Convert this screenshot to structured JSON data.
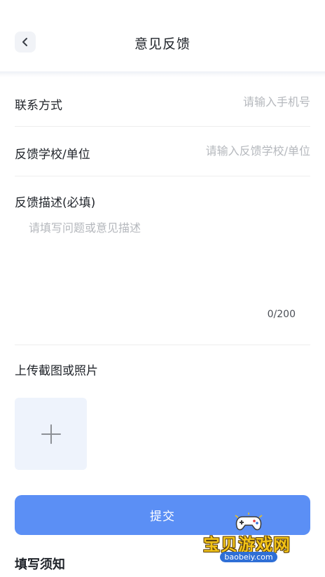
{
  "header": {
    "title": "意见反馈"
  },
  "form": {
    "contact": {
      "label": "联系方式",
      "placeholder": "请输入手机号",
      "value": ""
    },
    "school": {
      "label": "反馈学校/单位",
      "placeholder": "请输入反馈学校/单位",
      "value": ""
    },
    "description": {
      "label": "反馈描述(必填)",
      "placeholder": "请填写问题或意见描述",
      "value": "",
      "counter": "0/200"
    },
    "upload": {
      "label": "上传截图或照片",
      "icon": "plus-icon"
    },
    "submit_label": "提交"
  },
  "notice": {
    "title": "填写须知"
  },
  "watermark": {
    "text": "宝贝游戏网",
    "url": "baobeiy.com"
  },
  "colors": {
    "accent": "#5b8ff5",
    "upload_bg": "#eef3fc",
    "placeholder": "#b5b8bd"
  }
}
